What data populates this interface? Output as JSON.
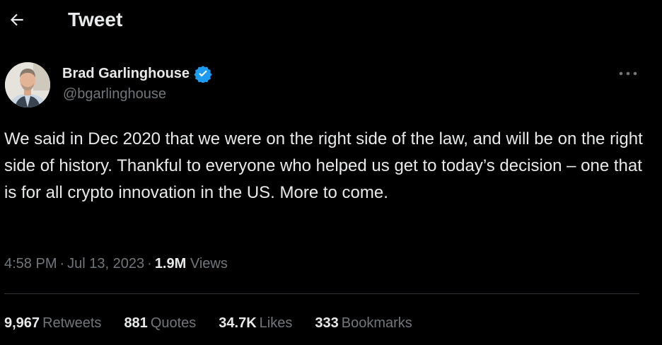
{
  "header": {
    "back_icon": "arrow-left-icon",
    "title": "Tweet"
  },
  "author": {
    "avatar_icon": "avatar-photo",
    "name": "Brad Garlinghouse",
    "verified_icon": "verified-badge-icon",
    "handle": "@bgarlinghouse",
    "more_icon": "more-dots-icon"
  },
  "tweet": {
    "text": "We said in Dec 2020 that we were on the right side of the law, and will be on the right side of history. Thankful to everyone who helped us get to today’s decision – one that is for all crypto innovation in the US. More to come."
  },
  "meta": {
    "time": "4:58 PM",
    "separator": "·",
    "date": "Jul 13, 2023",
    "views_count": "1.9M",
    "views_label": "Views"
  },
  "stats": [
    {
      "count": "9,967",
      "label": "Retweets"
    },
    {
      "count": "881",
      "label": "Quotes"
    },
    {
      "count": "34.7K",
      "label": "Likes"
    },
    {
      "count": "333",
      "label": "Bookmarks"
    }
  ],
  "colors": {
    "background": "#000000",
    "primary_text": "#e7e9ea",
    "secondary_text": "#71767b",
    "verified_blue": "#1d9bf0",
    "divider": "#2f3336"
  }
}
